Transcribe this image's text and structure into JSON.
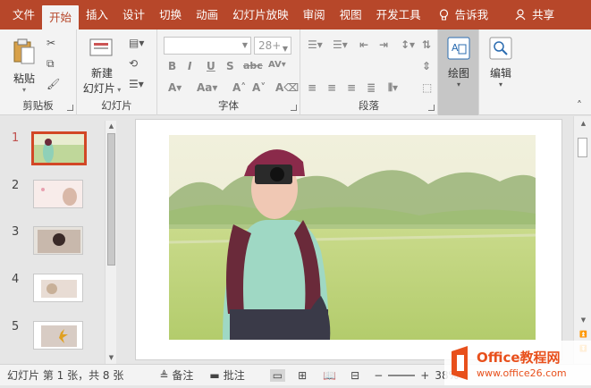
{
  "tabs": [
    {
      "label": "文件",
      "active": false
    },
    {
      "label": "开始",
      "active": true
    },
    {
      "label": "插入",
      "active": false
    },
    {
      "label": "设计",
      "active": false
    },
    {
      "label": "切换",
      "active": false
    },
    {
      "label": "动画",
      "active": false
    },
    {
      "label": "幻灯片放映",
      "active": false
    },
    {
      "label": "审阅",
      "active": false
    },
    {
      "label": "视图",
      "active": false
    },
    {
      "label": "开发工具",
      "active": false
    }
  ],
  "tell_me": "告诉我",
  "share": "共享",
  "ribbon": {
    "clipboard": {
      "label": "剪贴板",
      "paste": "粘贴"
    },
    "slides": {
      "label": "幻灯片",
      "new_slide_1": "新建",
      "new_slide_2": "幻灯片"
    },
    "font": {
      "label": "字体",
      "font_name": "",
      "font_size": "28+"
    },
    "paragraph": {
      "label": "段落"
    },
    "drawing": {
      "label": "绘图"
    },
    "editing": {
      "label": "编辑"
    }
  },
  "thumbnails": [
    {
      "num": "1",
      "selected": true
    },
    {
      "num": "2",
      "selected": false
    },
    {
      "num": "3",
      "selected": false
    },
    {
      "num": "4",
      "selected": false
    },
    {
      "num": "5",
      "selected": false
    }
  ],
  "status": {
    "slide_info": "幻灯片 第 1 张，共 8 张",
    "notes": "备注",
    "comments": "批注",
    "zoom": "38%"
  },
  "watermark": {
    "brand": "Office教程网",
    "url": "www.office26.com"
  },
  "colors": {
    "accent": "#b7472a",
    "selection": "#d24726"
  }
}
